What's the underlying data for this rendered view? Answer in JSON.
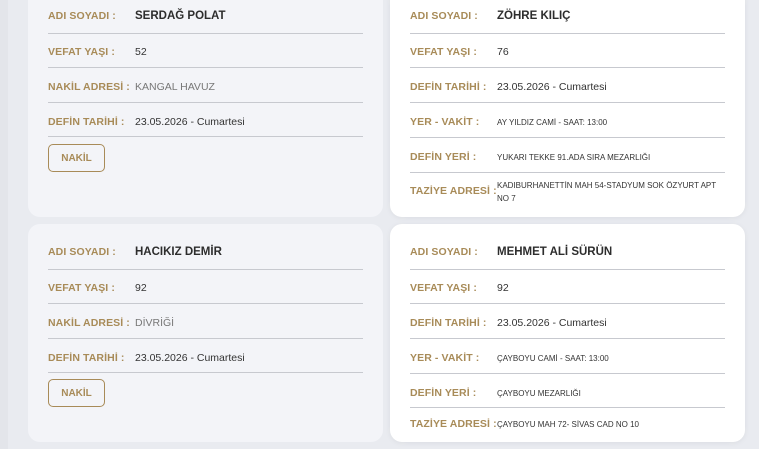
{
  "labels": {
    "name": "ADI SOYADI :",
    "age": "VEFAT YAŞI :",
    "transfer_address": "NAKİL ADRESİ :",
    "burial_date": "DEFİN TARİHİ :",
    "place_time": "YER - VAKİT :",
    "burial_place": "DEFİN YERİ :",
    "condolence_address": "TAZİYE ADRESİ :"
  },
  "nakil_cards": [
    {
      "name": "SERDAĞ POLAT",
      "age": "52",
      "transfer_address": "KANGAL HAVUZ",
      "burial_date": "23.05.2026 - Cumartesi",
      "button": "NAKİL"
    },
    {
      "name": "HACIKIZ DEMİR",
      "age": "92",
      "transfer_address": "DİVRİĞİ",
      "burial_date": "23.05.2026 - Cumartesi",
      "button": "NAKİL"
    }
  ],
  "burial_cards": [
    {
      "name": "ZÖHRE KILIÇ",
      "age": "76",
      "burial_date": "23.05.2026 - Cumartesi",
      "place_time": "AY YILDIZ CAMİ - SAAT: 13:00",
      "burial_place": "YUKARI TEKKE 91.ADA SIRA MEZARLIĞI",
      "condolence_address": "KADIBURHANETTİN MAH 54-STADYUM SOK ÖZYURT APT NO 7"
    },
    {
      "name": "MEHMET ALİ SÜRÜN",
      "age": "92",
      "burial_date": "23.05.2026 - Cumartesi",
      "place_time": "ÇAYBOYU CAMİ - SAAT: 13:00",
      "burial_place": "ÇAYBOYU MEZARLIĞI",
      "condolence_address": "ÇAYBOYU MAH 72- SİVAS CAD NO 10"
    }
  ],
  "colors": {
    "accent": "#a88b58",
    "card_grey": "#f3f4f8",
    "card_white": "#ffffff",
    "divider": "#c7c9cf"
  }
}
